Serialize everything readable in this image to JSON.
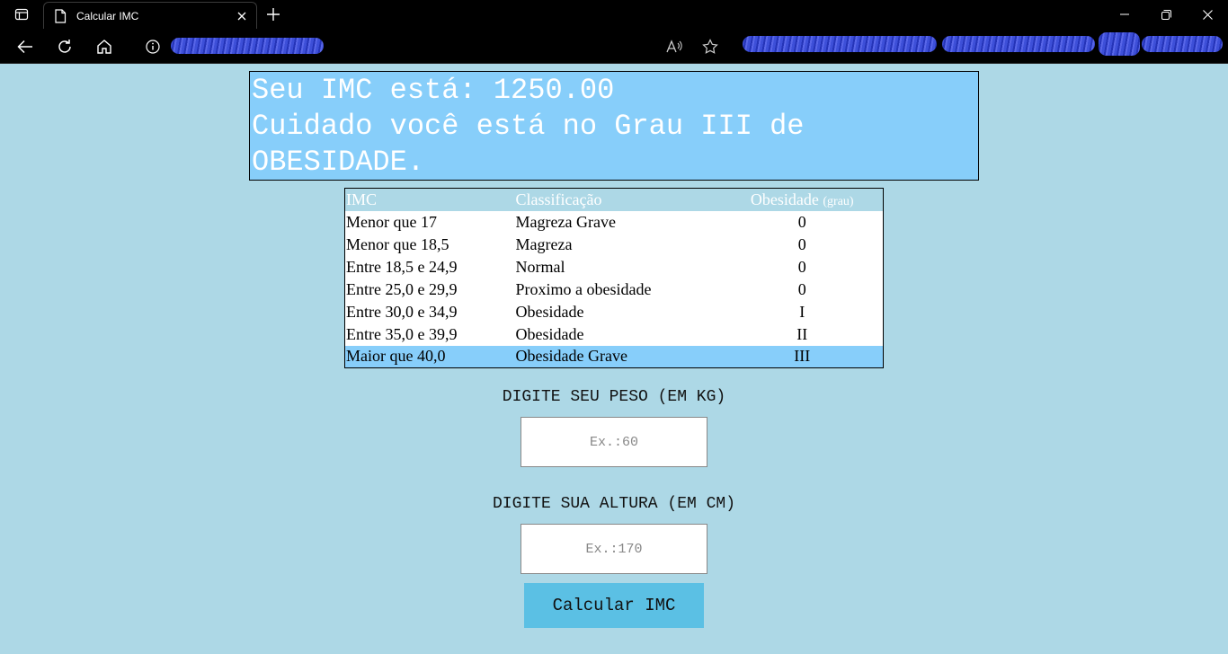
{
  "browser": {
    "tab_title": "Calcular IMC"
  },
  "result": {
    "line1": "Seu IMC está: 1250.00",
    "line2": "Cuidado você está no Grau III de OBESIDADE."
  },
  "table": {
    "headers": {
      "imc": "IMC",
      "classificacao": "Classificação",
      "obesidade": "Obesidade",
      "obesidade_unit": "(grau)"
    },
    "rows": [
      {
        "imc": "Menor que 17",
        "classificacao": "Magreza Grave",
        "grau": "0"
      },
      {
        "imc": "Menor que 18,5",
        "classificacao": "Magreza",
        "grau": "0"
      },
      {
        "imc": "Entre 18,5 e 24,9",
        "classificacao": "Normal",
        "grau": "0"
      },
      {
        "imc": "Entre 25,0 e 29,9",
        "classificacao": "Proximo a obesidade",
        "grau": "0"
      },
      {
        "imc": "Entre 30,0 e 34,9",
        "classificacao": "Obesidade",
        "grau": "I"
      },
      {
        "imc": "Entre 35,0 e 39,9",
        "classificacao": "Obesidade",
        "grau": "II"
      },
      {
        "imc": "Maior que 40,0",
        "classificacao": "Obesidade Grave",
        "grau": "III"
      }
    ]
  },
  "form": {
    "peso_label": "DIGITE SEU PESO (EM KG)",
    "peso_placeholder": "Ex.:60",
    "altura_label": "DIGITE SUA ALTURA (EM CM)",
    "altura_placeholder": "Ex.:170",
    "button_label": "Calcular IMC"
  },
  "colors": {
    "page_bg": "#add8e6",
    "result_bg": "#87cefa",
    "highlight_row": "#87cefa",
    "button_bg": "#5bc0e4"
  }
}
